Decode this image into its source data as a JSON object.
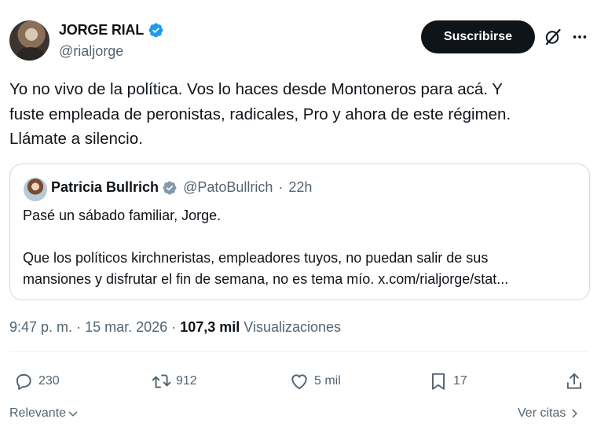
{
  "author": {
    "name": "JORGE RIAL",
    "handle": "@rialjorge",
    "verified_color": "#1d9bf0"
  },
  "header": {
    "subscribe_label": "Suscribirse",
    "grok_icon": "grok-icon",
    "more_icon": "more-icon"
  },
  "tweet": {
    "lines": [
      "Yo no vivo de la política. Vos lo haces desde Montoneros para acá. Y",
      "fuste empleada de peronistas, radicales, Pro y ahora de este régimen.",
      "Llámate a silencio."
    ]
  },
  "quote": {
    "name": "Patricia Bullrich",
    "handle": "@PatoBullrich",
    "separator": "·",
    "time": "22h",
    "verified_color": "#829aab",
    "lines": [
      "Pasé un sábado familiar, Jorge.",
      "Que los políticos kirchneristas, empleadores tuyos, no puedan salir de sus",
      "mansiones y disfrutar el fin de semana, no es tema mío. x.com/rialjorge/stat..."
    ]
  },
  "meta": {
    "time": "9:47 p. m.",
    "date": "15 mar. 2026",
    "sep": "·",
    "views_count": "107,3 mil",
    "views_label": "Visualizaciones"
  },
  "actions": {
    "replies": "230",
    "retweets": "912",
    "likes": "5 mil",
    "bookmarks": "17"
  },
  "footer": {
    "sort_label": "Relevante",
    "quotes_label": "Ver citas"
  }
}
